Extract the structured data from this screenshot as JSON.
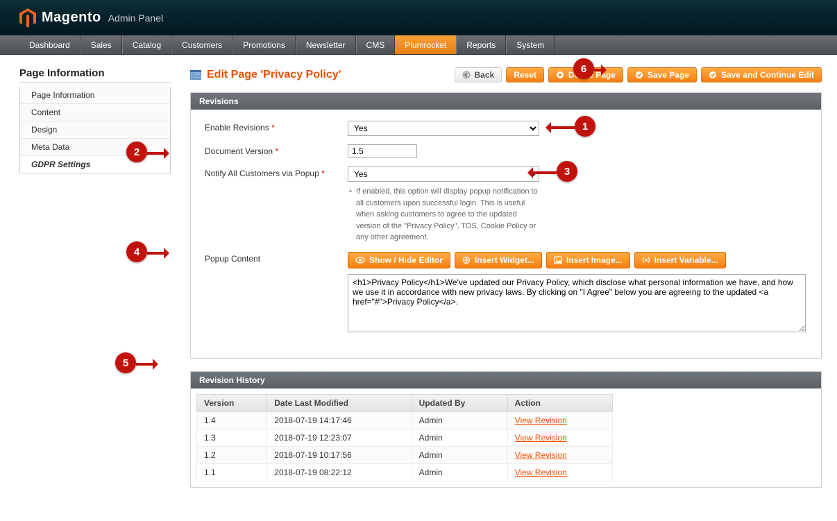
{
  "header": {
    "brand": "Magento",
    "sub": "Admin Panel"
  },
  "topnav": [
    {
      "label": "Dashboard"
    },
    {
      "label": "Sales"
    },
    {
      "label": "Catalog"
    },
    {
      "label": "Customers"
    },
    {
      "label": "Promotions"
    },
    {
      "label": "Newsletter"
    },
    {
      "label": "CMS"
    },
    {
      "label": "Plumrocket",
      "active": true
    },
    {
      "label": "Reports"
    },
    {
      "label": "System"
    }
  ],
  "sidebar": {
    "title": "Page Information",
    "items": [
      {
        "label": "Page Information"
      },
      {
        "label": "Content"
      },
      {
        "label": "Design"
      },
      {
        "label": "Meta Data"
      },
      {
        "label": "GDPR Settings",
        "active": true
      }
    ]
  },
  "page": {
    "title": "Edit Page 'Privacy Policy'",
    "buttons": {
      "back": "Back",
      "reset": "Reset",
      "delete": "Delete Page",
      "save": "Save Page",
      "save_continue": "Save and Continue Edit"
    }
  },
  "sections": {
    "revisions": {
      "title": "Revisions",
      "fields": {
        "enable_revisions": {
          "label": "Enable Revisions",
          "value": "Yes"
        },
        "document_version": {
          "label": "Document Version",
          "value": "1.5"
        },
        "notify_popup": {
          "label": "Notify All Customers via Popup",
          "value": "Yes",
          "hint": "If enabled, this option will display popup notification to all customers upon successful login. This is useful when asking customers to agree to the updated version of the \"Privacy Policy\", TOS, Cookie Policy or any other agreement."
        },
        "popup_content": {
          "label": "Popup Content",
          "editor_buttons": {
            "toggle": "Show / Hide Editor",
            "widget": "Insert Widget...",
            "image": "Insert Image...",
            "variable": "Insert Variable..."
          },
          "value": "<h1>Privacy Policy</h1>We've updated our Privacy Policy, which disclose what personal information we have, and how we use it in accordance with new privacy laws. By clicking on \"I Agree\" below you are agreeing to the updated <a href=\"#\">Privacy Policy</a>."
        }
      }
    },
    "history": {
      "title": "Revision History",
      "columns": [
        "Version",
        "Date Last Modified",
        "Updated By",
        "Action"
      ],
      "action_label": "View Revision",
      "rows": [
        {
          "version": "1.4",
          "date": "2018-07-19 14:17:46",
          "user": "Admin"
        },
        {
          "version": "1.3",
          "date": "2018-07-19 12:23:07",
          "user": "Admin"
        },
        {
          "version": "1.2",
          "date": "2018-07-19 10:17:56",
          "user": "Admin"
        },
        {
          "version": "1.1",
          "date": "2018-07-19 08:22:12",
          "user": "Admin"
        }
      ]
    }
  },
  "callouts": {
    "1": "1",
    "2": "2",
    "3": "3",
    "4": "4",
    "5": "5",
    "6": "6"
  }
}
